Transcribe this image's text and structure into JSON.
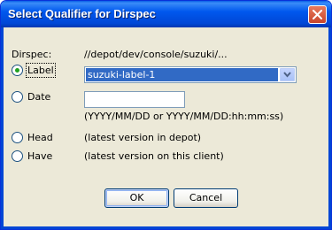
{
  "window": {
    "title": "Select Qualifier for Dirspec"
  },
  "dirspec": {
    "label": "Dirspec:",
    "path": "//depot/dev/console/suzuki/..."
  },
  "options": {
    "label": {
      "text": "Label",
      "selected": true,
      "combo_value": "suzuki-label-1"
    },
    "date": {
      "text": "Date",
      "selected": false,
      "input_value": "",
      "hint": "(YYYY/MM/DD or YYYY/MM/DD:hh:mm:ss)"
    },
    "head": {
      "text": "Head",
      "selected": false,
      "hint": "(latest version in depot)"
    },
    "have": {
      "text": "Have",
      "selected": false,
      "hint": "(latest version on this client)"
    }
  },
  "buttons": {
    "ok": "OK",
    "cancel": "Cancel"
  },
  "colors": {
    "title_bar": "#0058ee",
    "selection": "#316ac5",
    "radio_dot": "#21a121",
    "dialog_bg": "#ece9d8"
  },
  "icons": {
    "close": "close-icon",
    "dropdown": "chevron-down-icon"
  }
}
